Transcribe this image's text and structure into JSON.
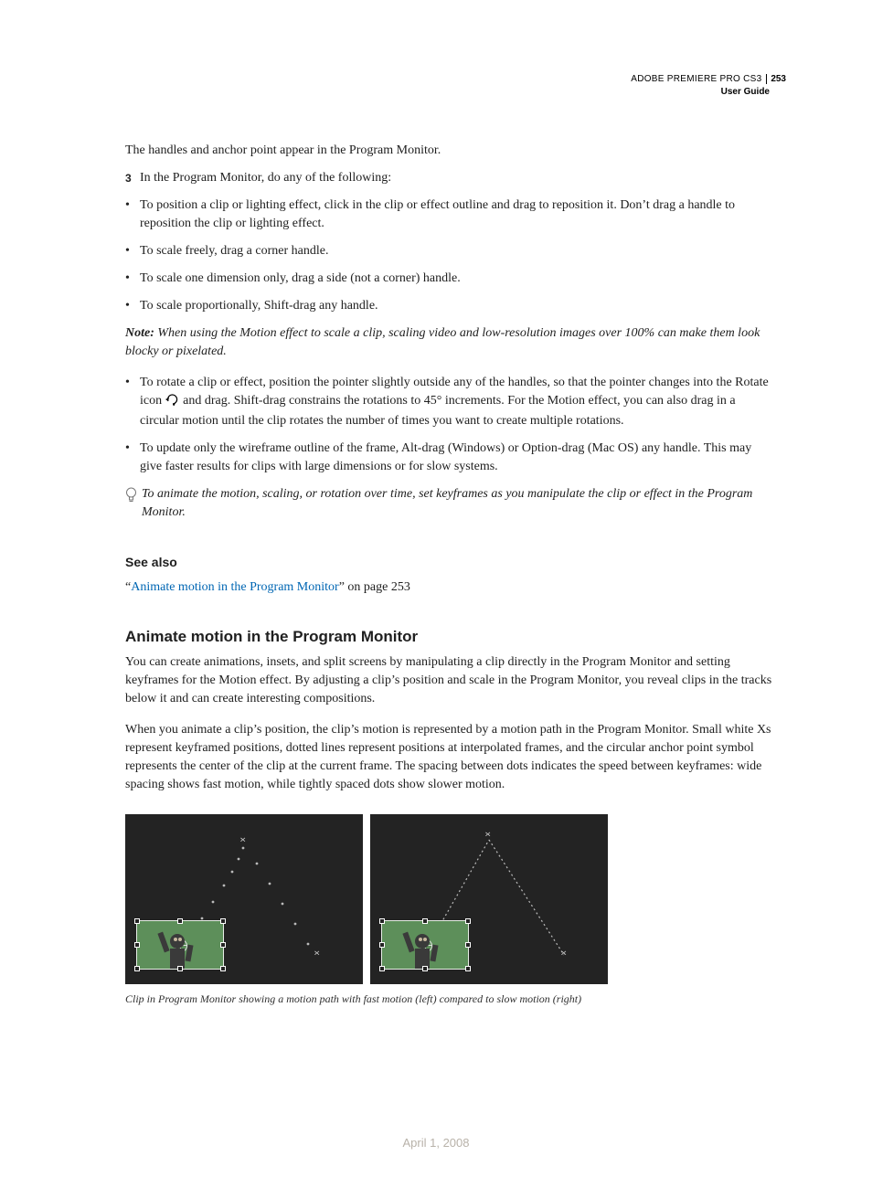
{
  "header": {
    "product": "ADOBE PREMIERE PRO CS3",
    "page": "253",
    "guide": "User Guide"
  },
  "intro": "The handles and anchor point appear in the Program Monitor.",
  "step3": {
    "num": "3",
    "text": "In the Program Monitor, do any of the following:"
  },
  "bullets1": [
    "To position a clip or lighting effect, click in the clip or effect outline and drag to reposition it. Don’t drag a handle to reposition the clip or lighting effect.",
    "To scale freely, drag a corner handle.",
    "To scale one dimension only, drag a side (not a corner) handle.",
    "To scale proportionally, Shift-drag any handle."
  ],
  "note": {
    "label": "Note:",
    "text": " When using the Motion effect to scale a clip, scaling video and low-resolution images over 100% can make them look blocky or pixelated."
  },
  "rotate_bullet": {
    "before": "To rotate a clip or effect, position the pointer slightly outside any of the handles, so that the pointer changes into the Rotate icon ",
    "after": " and drag. Shift-drag constrains the rotations to 45° increments. For the Motion effect, you can also drag in a circular motion until the clip rotates the number of times you want to create multiple rotations."
  },
  "bullets2": [
    "To update only the wireframe outline of the frame, Alt-drag (Windows) or Option-drag (Mac OS) any handle. This may give faster results for clips with large dimensions or for slow systems."
  ],
  "tip": "To animate the motion, scaling, or rotation over time, set keyframes as you manipulate the clip or effect in the Program Monitor.",
  "see_also": {
    "heading": "See also",
    "open_q": "“",
    "link": "Animate motion in the Program Monitor",
    "close": "” on page 253"
  },
  "section": {
    "heading": "Animate motion in the Program Monitor",
    "p1": "You can create animations, insets, and split screens by manipulating a clip directly in the Program Monitor and setting keyframes for the Motion effect. By adjusting a clip’s position and scale in the Program Monitor, you reveal clips in the tracks below it and can create interesting compositions.",
    "p2": "When you animate a clip’s position, the clip’s motion is represented by a motion path in the Program Monitor. Small white Xs represent keyframed positions, dotted lines represent positions at interpolated frames, and the circular anchor point symbol represents the center of the clip at the current frame. The spacing between dots indicates the speed between keyframes: wide spacing shows fast motion, while tightly spaced dots show slower motion."
  },
  "caption": "Clip in Program Monitor showing a motion path with fast motion (left) compared to slow motion (right)",
  "footer_date": "April 1, 2008"
}
